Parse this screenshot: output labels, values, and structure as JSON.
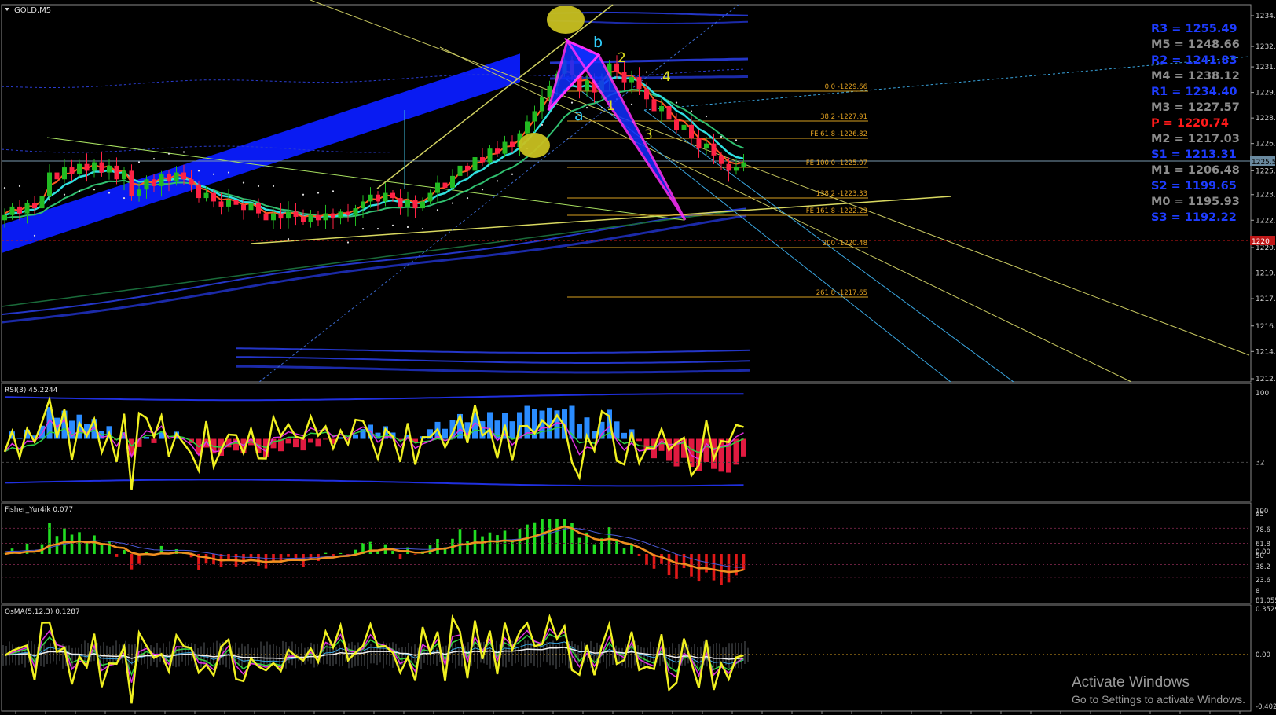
{
  "window": {
    "title": "GOLD,M5",
    "colors": {
      "background": "#000000",
      "bull": "#22bb22",
      "bear": "#ff2244",
      "grid": "#333333"
    }
  },
  "main": {
    "price_labels": [
      "1234.2",
      "1232.4",
      "1231.2",
      "1229.7",
      "1228.2",
      "1226.7",
      "1225.1",
      "1223.7",
      "1222.2",
      "1220.6",
      "1219.1",
      "1217.6",
      "1216.0",
      "1214.5",
      "1212.9"
    ],
    "current_price_tag": "1225.5",
    "red_level_tag": "1220",
    "pivots": [
      {
        "label": "R3",
        "value": "1255.49",
        "color": "#1e3cff"
      },
      {
        "label": "M5",
        "value": "1248.66",
        "color": "#8c8c8c"
      },
      {
        "label": "R2",
        "value": "1241.83",
        "color": "#1e3cff"
      },
      {
        "label": "M4",
        "value": "1238.12",
        "color": "#8c8c8c"
      },
      {
        "label": "R1",
        "value": "1234.40",
        "color": "#1e3cff"
      },
      {
        "label": "M3",
        "value": "1227.57",
        "color": "#8c8c8c"
      },
      {
        "label": "P",
        "value": "1220.74",
        "color": "#ff1a1a"
      },
      {
        "label": "M2",
        "value": "1217.03",
        "color": "#8c8c8c"
      },
      {
        "label": "S1",
        "value": "1213.31",
        "color": "#1e3cff"
      },
      {
        "label": "M1",
        "value": "1206.48",
        "color": "#8c8c8c"
      },
      {
        "label": "S2",
        "value": "1199.65",
        "color": "#1e3cff"
      },
      {
        "label": "M0",
        "value": "1195.93",
        "color": "#8c8c8c"
      },
      {
        "label": "S3",
        "value": "1192.22",
        "color": "#1e3cff"
      }
    ],
    "fib_levels": [
      {
        "text": "0.0 -1229.66"
      },
      {
        "text": "38.2 -1227.91"
      },
      {
        "text": "FE 61.8 -1226.82"
      },
      {
        "text": "FE 100.0 -1225.07"
      },
      {
        "text": "138.2 -1223.33"
      },
      {
        "text": "FE 161.8 -1222.23"
      },
      {
        "text": "200 -1220.48"
      },
      {
        "text": "261.8 -1217.65"
      }
    ],
    "wave_labels": {
      "b": "b",
      "a": "a",
      "w1": "1",
      "w2": "2",
      "w3": "3",
      "w4": "4"
    }
  },
  "rsi": {
    "title": "RSI(3) 45.2244",
    "scale": [
      "100",
      "32"
    ]
  },
  "fisher": {
    "title": "Fisher_Yur4ik 0.077",
    "scale": [
      "100",
      "95",
      "78.6",
      "61.8",
      "0.00",
      "50",
      "38.2",
      "23.6",
      "8",
      "81.055"
    ]
  },
  "osma": {
    "title": "OsMA(5,12,3) 0.1287",
    "scale": [
      "0.3529",
      "0.00",
      "-0.4021"
    ]
  },
  "watermark": {
    "line1": "Activate Windows",
    "line2": "Go to Settings to activate Windows."
  },
  "chart_data": {
    "type": "candlestick",
    "title": "GOLD,M5",
    "ylim": [
      1212.9,
      1234.2
    ],
    "close": [
      1222.5,
      1223.0,
      1222.6,
      1223.2,
      1222.9,
      1223.6,
      1225.0,
      1224.6,
      1225.3,
      1224.9,
      1225.5,
      1225.1,
      1225.6,
      1225.0,
      1225.4,
      1224.6,
      1225.1,
      1223.6,
      1224.0,
      1224.6,
      1224.2,
      1224.9,
      1224.5,
      1225.0,
      1224.6,
      1224.3,
      1223.5,
      1223.8,
      1223.3,
      1223.0,
      1223.4,
      1223.1,
      1222.8,
      1223.2,
      1222.6,
      1222.2,
      1222.6,
      1222.3,
      1222.7,
      1222.4,
      1222.1,
      1222.5,
      1222.2,
      1222.6,
      1222.3,
      1222.7,
      1222.5,
      1222.9,
      1223.3,
      1223.7,
      1223.3,
      1223.8,
      1223.5,
      1223.0,
      1223.4,
      1222.9,
      1223.3,
      1223.8,
      1224.4,
      1224.1,
      1224.8,
      1225.4,
      1225.1,
      1225.9,
      1225.6,
      1226.4,
      1226.1,
      1226.8,
      1226.5,
      1227.3,
      1228.0,
      1228.6,
      1229.4,
      1230.1,
      1230.8,
      1231.6,
      1230.7,
      1229.8,
      1230.4,
      1229.7,
      1230.4,
      1231.4,
      1230.9,
      1230.3,
      1230.6,
      1229.9,
      1229.3,
      1228.6,
      1228.9,
      1228.1,
      1227.5,
      1227.8,
      1227.0,
      1226.4,
      1226.7,
      1226.0,
      1225.5,
      1225.1,
      1225.3,
      1225.6
    ]
  }
}
